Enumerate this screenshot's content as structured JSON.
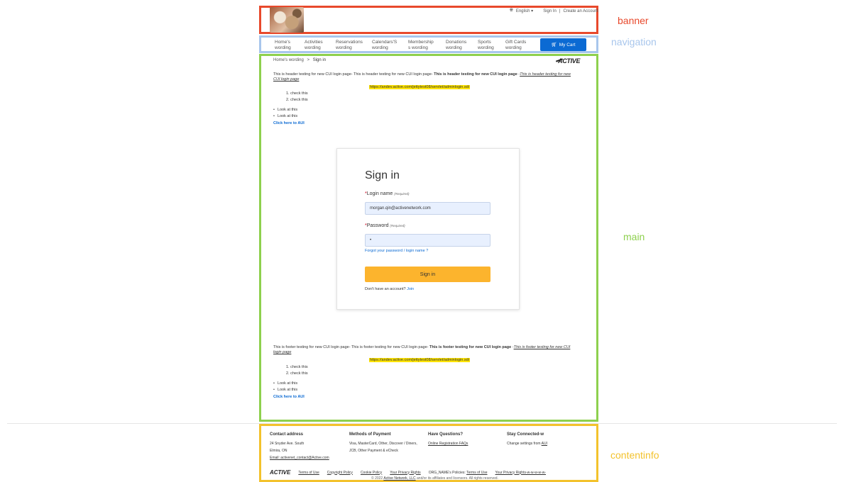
{
  "regions": {
    "banner": "banner",
    "navigation": "navigation",
    "main": "main",
    "contentinfo": "contentinfo"
  },
  "banner": {
    "language": "English",
    "sign_in": "Sign In",
    "separator": "|",
    "create_account": "Create an Account"
  },
  "nav": {
    "items": [
      {
        "line1": "Home's",
        "line2": "wording"
      },
      {
        "line1": "Activities",
        "line2": "wording"
      },
      {
        "line1": "Reservations",
        "line2": "wording"
      },
      {
        "line1": "Calendars'S",
        "line2": "wording"
      },
      {
        "line1": "Membership",
        "line2": "s wording"
      },
      {
        "line1": "Donations",
        "line2": "wording"
      },
      {
        "line1": "Sports",
        "line2": "wording"
      },
      {
        "line1": "Gift Cards",
        "line2": "wording"
      }
    ],
    "cart": "My Cart"
  },
  "breadcrumb": {
    "home": "Home's wording",
    "separator": ">",
    "current": "Sign in"
  },
  "logo_text": "ACTIVE",
  "header_block": {
    "text_plain": "This is header testing for new CUI login page- This is header testing for new CUI login page- ",
    "text_bold": "This is header testing for new CUI login page",
    "text_dash": " -",
    "text_italic": "This is header testing for new CUI login page",
    "url": "https://andev.active.com/jettytest08/servlet/adminlogin.sdi",
    "ol": [
      "1. check this",
      "2. check this"
    ],
    "ul": [
      "Look at this",
      "Look at this"
    ],
    "link": "Click here to AUI"
  },
  "login": {
    "title": "Sign in",
    "login_label": "Login name",
    "required": "(Required)",
    "login_value": "morgan.qin@activenetwork.com",
    "password_label": "Password",
    "password_value": "•",
    "forgot": "Forgot your password / login name ?",
    "submit": "Sign in",
    "no_account": "Don't have an account?",
    "join": "Join"
  },
  "footer_block": {
    "text_plain": "This is footer testing for new CUI login page- This is footer testing for new CUI login page- ",
    "text_bold": "This is footer testing for new CUI login page",
    "text_dash": " -",
    "text_italic": "This is footer testing for new CUI login page",
    "url": "https://andev.active.com/jettytest08/servlet/adminlogin.sdi",
    "ol": [
      "1. check this",
      "2. check this"
    ],
    "ul": [
      "Look at this",
      "Look at this"
    ],
    "link": "Click here to AUI"
  },
  "contentinfo": {
    "contact_head": "Contact address",
    "contact_line1": "24 Snyder Ave. South",
    "contact_line2": "Elmira, ON",
    "contact_email": "Email: activenet_contact@Active.com",
    "payment_head": "Methods of Payment",
    "payment_line1": "Visa, MasterCard, Other, Discover / Diners,",
    "payment_line2": "JCB, Other Payment & eCheck",
    "questions_head": "Have Questions?",
    "questions_link": "Online Registration FAQs",
    "connected_head": "Stay Connected-w",
    "connected_text": "Change settings from",
    "connected_link": "AUI",
    "links": {
      "terms": "Terms of Use",
      "copyright": "Copyright Policy",
      "cookie": "Cookie Policy",
      "privacy": "Your Privacy Rights",
      "org_policies": "ORG_NAME's Policies:",
      "org_terms": "Terms of Use",
      "org_privacy": "Your Privacy Rights-w-w-w-w-w-"
    },
    "copyright_pre": "© 2022",
    "copyright_company": "Active Network, LLC",
    "copyright_post": "and/or its affiliates and licensors. All rights reserved."
  },
  "colors": {
    "banner": "#e8492c",
    "navigation": "#a8c6ec",
    "main": "#8ed04e",
    "contentinfo": "#f3c22c",
    "accent": "#0b6ad3",
    "button": "#fcb42d"
  }
}
